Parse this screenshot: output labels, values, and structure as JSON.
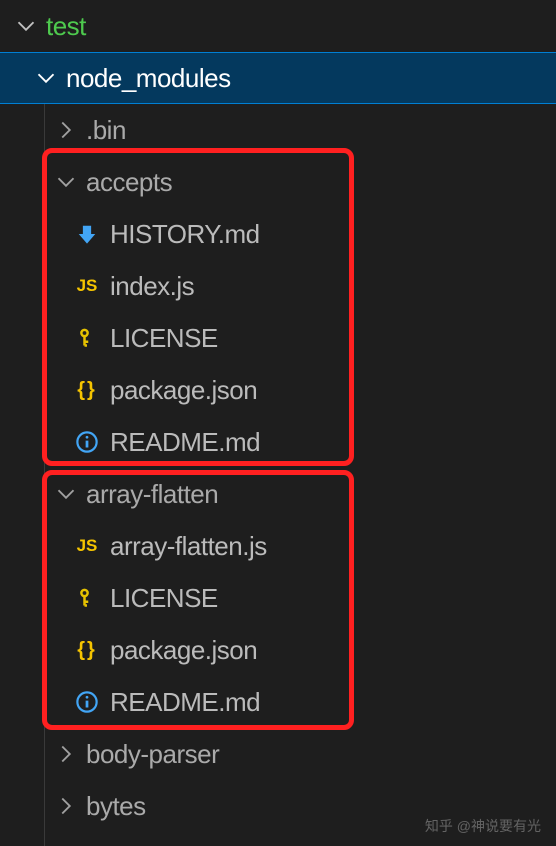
{
  "tree": {
    "root": "test",
    "node_modules": "node_modules",
    "bin": ".bin",
    "accepts": "accepts",
    "accepts_files": {
      "history": "HISTORY.md",
      "index": "index.js",
      "license": "LICENSE",
      "package": "package.json",
      "readme": "README.md"
    },
    "array_flatten": "array-flatten",
    "array_flatten_files": {
      "main": "array-flatten.js",
      "license": "LICENSE",
      "package": "package.json",
      "readme": "README.md"
    },
    "body_parser": "body-parser",
    "bytes": "bytes"
  },
  "watermark": "知乎 @神说要有光"
}
